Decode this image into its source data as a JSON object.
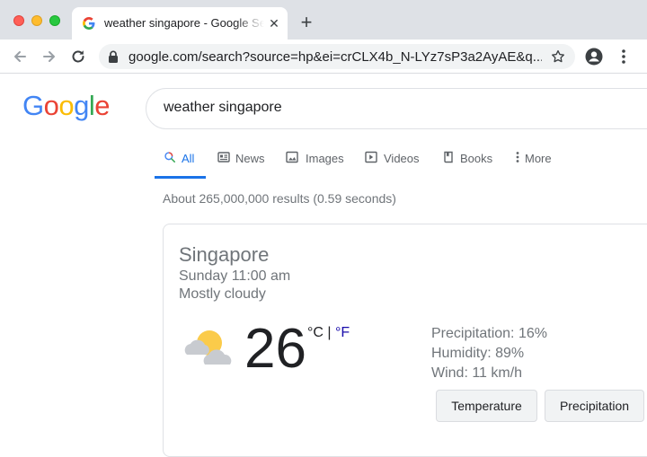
{
  "browser": {
    "tab_title": "weather singapore - Google Search",
    "url": "google.com/search?source=hp&ei=crCLX4b_N-LYz7sP3a2AyAE&q..."
  },
  "google": {
    "logo_letters": [
      "G",
      "o",
      "o",
      "g",
      "l",
      "e"
    ],
    "logo_colors": [
      "#4285F4",
      "#EA4335",
      "#FBBC05",
      "#4285F4",
      "#34A853",
      "#EA4335"
    ],
    "query": "weather singapore"
  },
  "search_tabs": [
    {
      "label": "All",
      "icon": "search-icon",
      "active": true
    },
    {
      "label": "News",
      "icon": "news-icon"
    },
    {
      "label": "Images",
      "icon": "image-icon"
    },
    {
      "label": "Videos",
      "icon": "video-icon"
    },
    {
      "label": "Books",
      "icon": "book-icon"
    },
    {
      "label": "More",
      "icon": "more-icon"
    }
  ],
  "result_stats": "About 265,000,000 results (0.59 seconds)",
  "weather": {
    "location": "Singapore",
    "datetime": "Sunday 11:00 am",
    "condition": "Mostly cloudy",
    "temperature": "26",
    "unit_c": "°C",
    "unit_sep": "|",
    "unit_f": "°F",
    "precipitation": "Precipitation: 16%",
    "humidity": "Humidity: 89%",
    "wind": "Wind: 11 km/h",
    "buttons": [
      "Temperature",
      "Precipitation"
    ]
  },
  "colors": {
    "accent": "#1a73e8",
    "link": "#1a0dab"
  }
}
